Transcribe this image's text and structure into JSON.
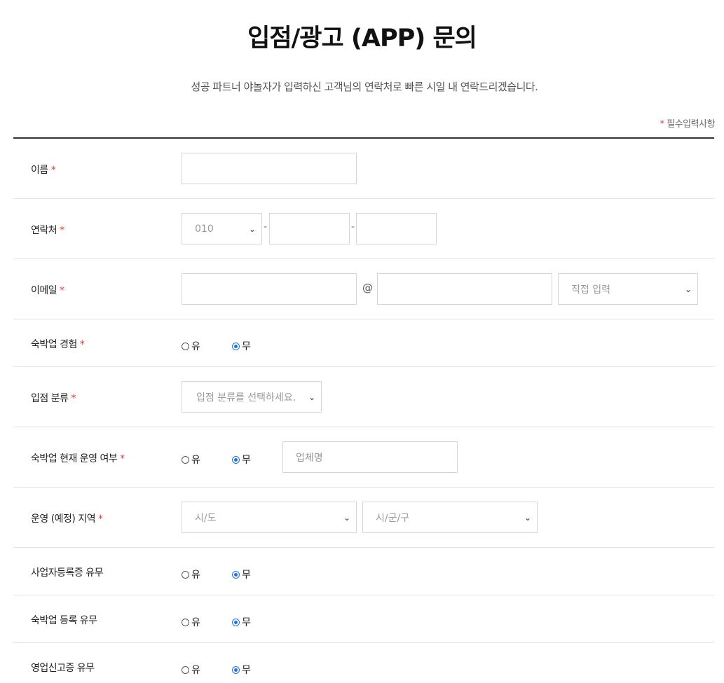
{
  "page": {
    "title": "입점/광고 (APP) 문의",
    "subtitle": "성공 파트너 야놀자가 입력하신 고객님의 연락처로 빠른 시일 내 연락드리겠습니다.",
    "required_star": "*",
    "required_note": "필수입력사항"
  },
  "form": {
    "name": {
      "label": "이름",
      "value": ""
    },
    "phone": {
      "label": "연락처",
      "prefix": "010",
      "dash": "-",
      "middle": "",
      "last": ""
    },
    "email": {
      "label": "이메일",
      "id": "",
      "at": "@",
      "domain": "",
      "domain_select": "직접 입력"
    },
    "lodging_experience": {
      "label": "숙박업 경험",
      "options": [
        "유",
        "무"
      ],
      "selected": "무"
    },
    "entry_category": {
      "label": "입점 분류",
      "placeholder": "입점 분류를 선택하세요."
    },
    "current_operation": {
      "label": "숙박업 현재 운영 여부",
      "options": [
        "유",
        "무"
      ],
      "selected": "무",
      "business_name_placeholder": "업체명"
    },
    "region": {
      "label": "운영 (예정) 지역",
      "city": "시/도",
      "district": "시/군/구"
    },
    "business_registration": {
      "label": "사업자등록증 유무",
      "options": [
        "유",
        "무"
      ],
      "selected": "무"
    },
    "lodging_registration": {
      "label": "숙박업 등록 유무",
      "options": [
        "유",
        "무"
      ],
      "selected": "무"
    },
    "business_report": {
      "label": "영업신고증 유무",
      "options": [
        "유",
        "무"
      ],
      "selected": "무"
    }
  },
  "icons": {
    "dropdown": "chevron-down-icon",
    "radio": "radio-icon"
  },
  "colors": {
    "required": "#e23c3c",
    "radio_selected": "#1a73e8",
    "divider": "#333333"
  }
}
